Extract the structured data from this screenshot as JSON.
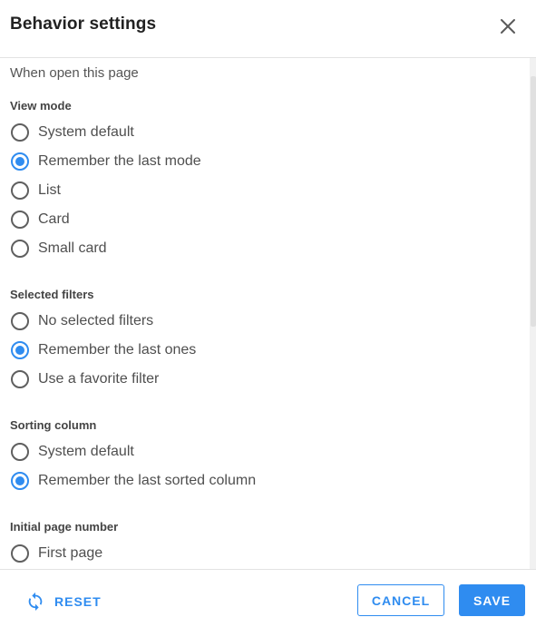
{
  "dialog": {
    "title": "Behavior settings",
    "close_icon": "close-icon"
  },
  "section": {
    "heading": "When open this page"
  },
  "view_mode": {
    "label": "View mode",
    "options": [
      {
        "label": "System default",
        "checked": false
      },
      {
        "label": "Remember the last mode",
        "checked": true
      },
      {
        "label": "List",
        "checked": false
      },
      {
        "label": "Card",
        "checked": false
      },
      {
        "label": "Small card",
        "checked": false
      }
    ]
  },
  "selected_filters": {
    "label": "Selected filters",
    "options": [
      {
        "label": "No selected filters",
        "checked": false
      },
      {
        "label": "Remember the last ones",
        "checked": true
      },
      {
        "label": "Use a favorite filter",
        "checked": false
      }
    ]
  },
  "sorting_column": {
    "label": "Sorting column",
    "options": [
      {
        "label": "System default",
        "checked": false
      },
      {
        "label": "Remember the last sorted column",
        "checked": true
      }
    ]
  },
  "initial_page_number": {
    "label": "Initial page number",
    "options": [
      {
        "label": "First page",
        "checked": false
      }
    ]
  },
  "footer": {
    "reset_label": "RESET",
    "reset_icon": "refresh-icon",
    "cancel_label": "CANCEL",
    "save_label": "SAVE"
  },
  "colors": {
    "accent": "#2f8cf0",
    "text": "#4f4f4f",
    "divider": "#e2e2e2"
  }
}
